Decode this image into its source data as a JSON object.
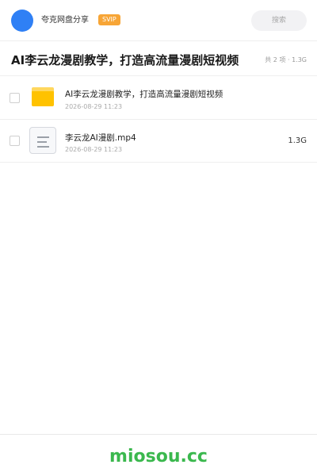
{
  "header": {
    "app_name": "夸克网盘分享",
    "badge": "SVIP",
    "search_placeholder": "搜索"
  },
  "share": {
    "title": "AI李云龙漫剧教学，打造高流量漫剧短视频",
    "summary": "共 2 项 · 1.3G"
  },
  "files": [
    {
      "name": "AI李云龙漫剧教学，打造高流量漫剧短视频",
      "date": "2026-08-29 11:23",
      "size": "",
      "type": "folder",
      "icon": "folder-icon"
    },
    {
      "name": "李云龙AI漫剧.mp4",
      "date": "2026-08-29 11:23",
      "size": "1.3G",
      "type": "file",
      "icon": "document-icon"
    }
  ],
  "footer": {
    "brand": "miosou.cc"
  },
  "colors": {
    "avatar": "#2f80f5",
    "badge": "#f7a536",
    "folder": "#ffc200",
    "brand": "#3bb84e"
  }
}
